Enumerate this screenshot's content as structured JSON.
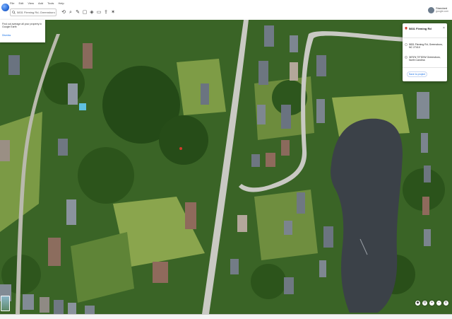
{
  "menubar": {
    "items": [
      "File",
      "Edit",
      "View",
      "Add",
      "Tools",
      "Help"
    ]
  },
  "toolbar": {
    "search_value": "5831 Fleming Rd, Greensboro",
    "icons": [
      "measure-icon",
      "zoom-icon",
      "draw-icon",
      "image-icon",
      "3d-icon",
      "folder-icon",
      "share-icon",
      "settings-icon"
    ]
  },
  "user": {
    "name": "Standard",
    "email": "google.com"
  },
  "promo": {
    "text": "Find out average all your property in Google Earth",
    "dismiss_label": "Dismiss"
  },
  "place_card": {
    "title": "5831 Fleming Rd",
    "address": "5831 Fleming Rd, Greensboro, NC 27410",
    "coordinates": "36°6′N 79°53′W Greensboro, North Carolina",
    "save_label": "Save to project"
  },
  "map_controls": [
    "compass-icon",
    "tilt-icon",
    "zoom-in-icon",
    "zoom-out-icon",
    "layers-icon"
  ],
  "colors": {
    "tree": "#2f5a1f",
    "grass": "#86a34a",
    "road": "#c9c9c3",
    "water": "#3b4148",
    "accent": "#1a73e8"
  }
}
